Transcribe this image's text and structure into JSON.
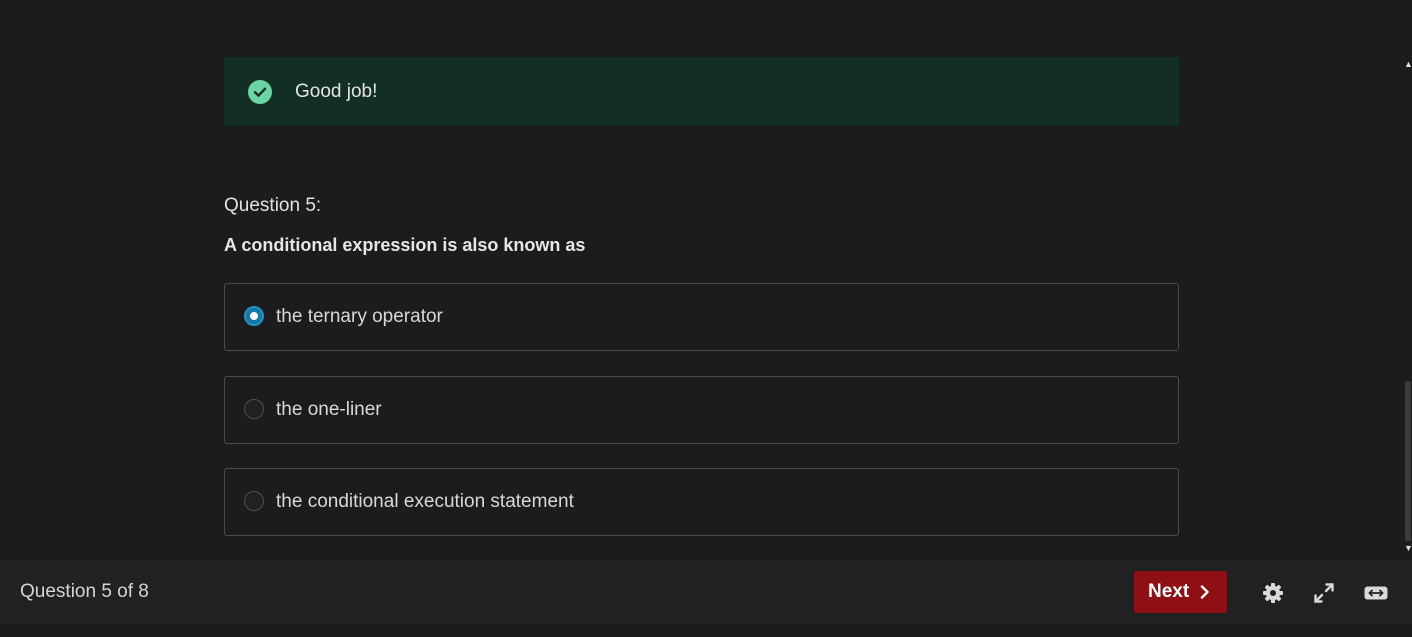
{
  "feedback": {
    "message": "Good job!",
    "icon": "check-circle-icon",
    "background": "#132e24",
    "icon_color": "#6bd4a3"
  },
  "question": {
    "number_label": "Question 5:",
    "text": "A conditional expression is also known as",
    "options": [
      {
        "label": "the ternary operator",
        "selected": true
      },
      {
        "label": "the one-liner",
        "selected": false
      },
      {
        "label": "the conditional execution statement",
        "selected": false
      }
    ]
  },
  "footer": {
    "progress": "Question 5 of 8",
    "next_label": "Next",
    "next_color": "#8e1014",
    "tools": [
      "gear-icon",
      "expand-icon",
      "widen-icon"
    ]
  }
}
